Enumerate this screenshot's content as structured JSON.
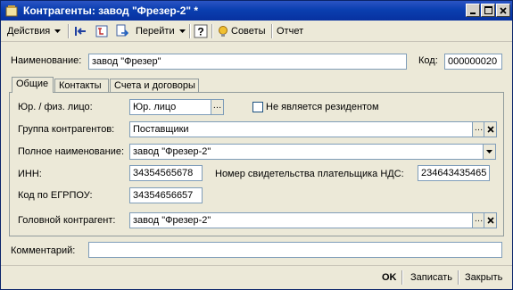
{
  "window": {
    "title": "Контрагенты: завод \"Фрезер-2\" *"
  },
  "toolbar": {
    "actions_label": "Действия",
    "goto_label": "Перейти",
    "tips_label": "Советы",
    "report_label": "Отчет"
  },
  "header": {
    "name_label": "Наименование:",
    "name_value": "завод \"Фрезер\"",
    "code_label": "Код:",
    "code_value": "000000020"
  },
  "tabs": [
    {
      "label": "Общие"
    },
    {
      "label": "Контакты"
    },
    {
      "label": "Счета и договоры"
    }
  ],
  "general": {
    "entity_type_label": "Юр. / физ. лицо:",
    "entity_type_value": "Юр. лицо",
    "nonresident_label": "Не является резидентом",
    "group_label": "Группа контрагентов:",
    "group_value": "Поставщики",
    "full_name_label": "Полное наименование:",
    "full_name_value": "завод \"Фрезер-2\"",
    "inn_label": "ИНН:",
    "inn_value": "34354565678",
    "vat_cert_label": "Номер свидетельства плательщика НДС:",
    "vat_cert_value": "234643435465",
    "edrpou_label": "Код по ЕГРПОУ:",
    "edrpou_value": "34354656657",
    "parent_label": "Головной контрагент:",
    "parent_value": "завод \"Фрезер-2\""
  },
  "comment": {
    "label": "Комментарий:",
    "value": ""
  },
  "buttons": {
    "ok_label": "OK",
    "save_label": "Записать",
    "close_label": "Закрыть"
  }
}
